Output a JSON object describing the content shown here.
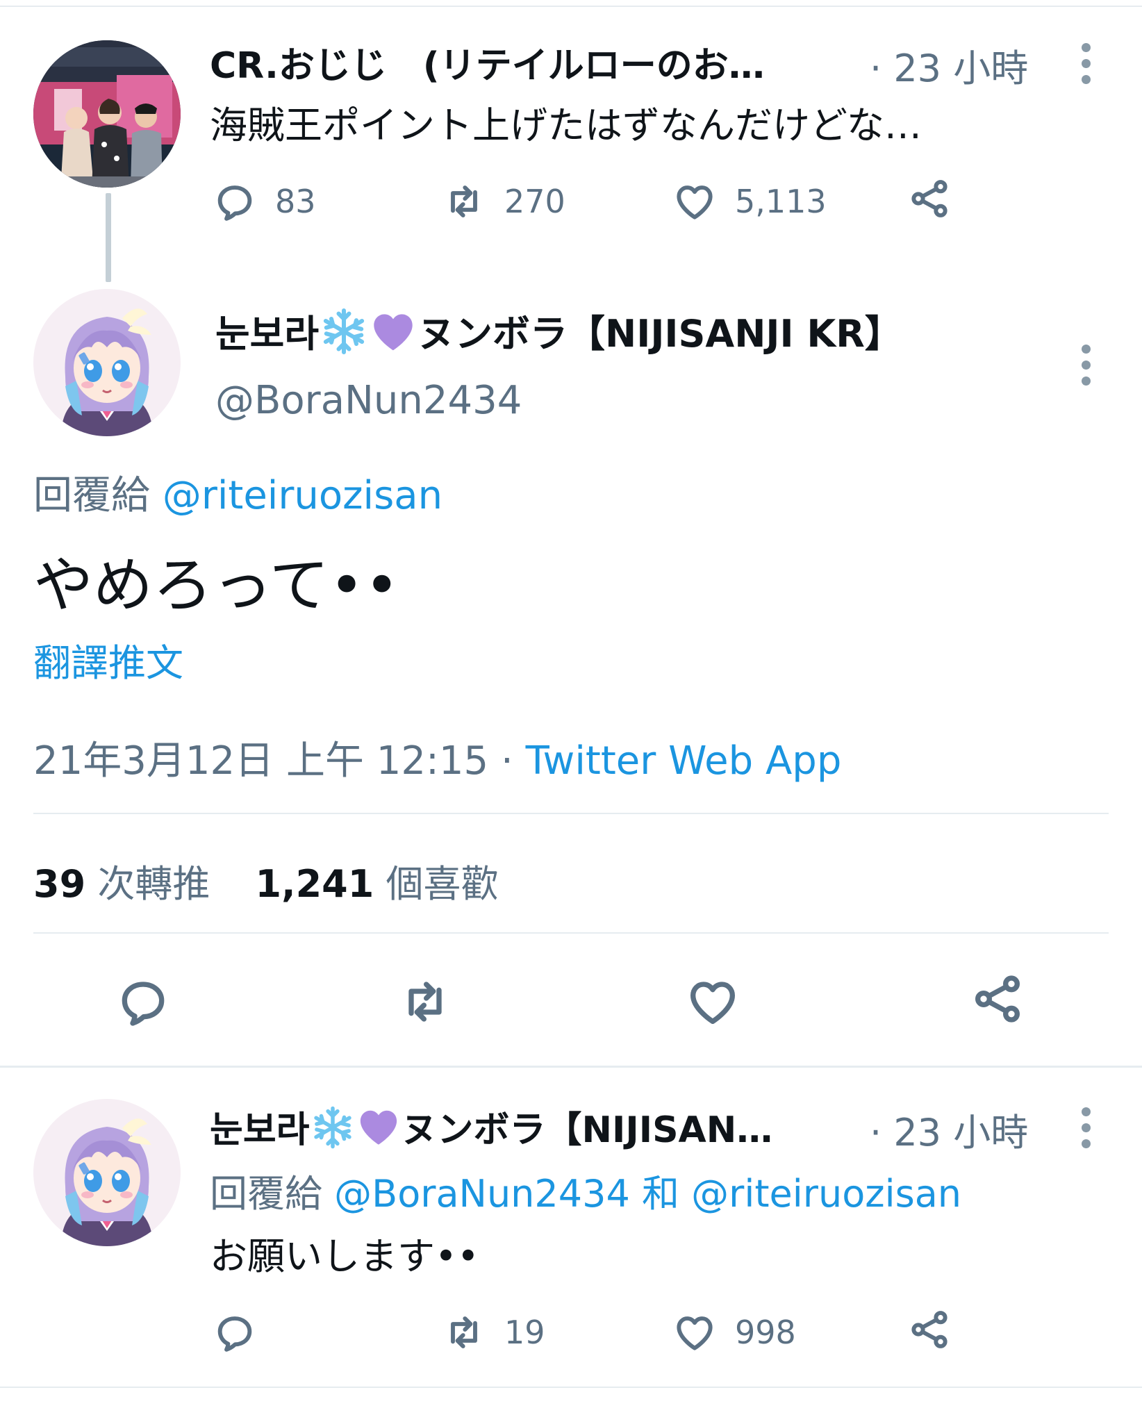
{
  "parent_tweet": {
    "display_name": "CR.おじじ　(リテイルローのお…",
    "time": "· 23 小時",
    "text": "海賊王ポイント上げたはずなんだけどな…",
    "replies": "83",
    "retweets": "270",
    "likes": "5,113"
  },
  "main_tweet": {
    "display_name_prefix": "눈보라",
    "display_name_suffix": "ヌンボラ【NIJISANJI KR】",
    "handle": "@BoraNun2434",
    "reply_label": "回覆給",
    "reply_to": "@riteiruozisan",
    "text": "やめろって••",
    "translate_label": "翻譯推文",
    "timestamp": "21年3月12日 上午 12:15",
    "separator": "·",
    "source": "Twitter Web App",
    "retweet_count": "39",
    "retweet_label": "次轉推",
    "like_count": "1,241",
    "like_label": "個喜歡"
  },
  "reply_tweet": {
    "display_name_prefix": "눈보라",
    "display_name_suffix": "ヌンボラ【NIJISAN…",
    "time": "· 23 小時",
    "reply_label": "回覆給",
    "reply_to_1": "@BoraNun2434",
    "and_label": "和",
    "reply_to_2": "@riteiruozisan",
    "text": "お願いします••",
    "replies": "",
    "retweets": "19",
    "likes": "998"
  },
  "colors": {
    "link": "#1b95e0",
    "muted": "#5b7083",
    "divider": "#e6ecf0",
    "heart_emoji": "#ab8ae0",
    "snowflake_emoji": "#6ec6f0"
  },
  "icons": [
    "reply-icon",
    "retweet-icon",
    "like-icon",
    "share-icon",
    "more-icon",
    "snowflake-emoji-icon",
    "purple-heart-emoji-icon"
  ]
}
